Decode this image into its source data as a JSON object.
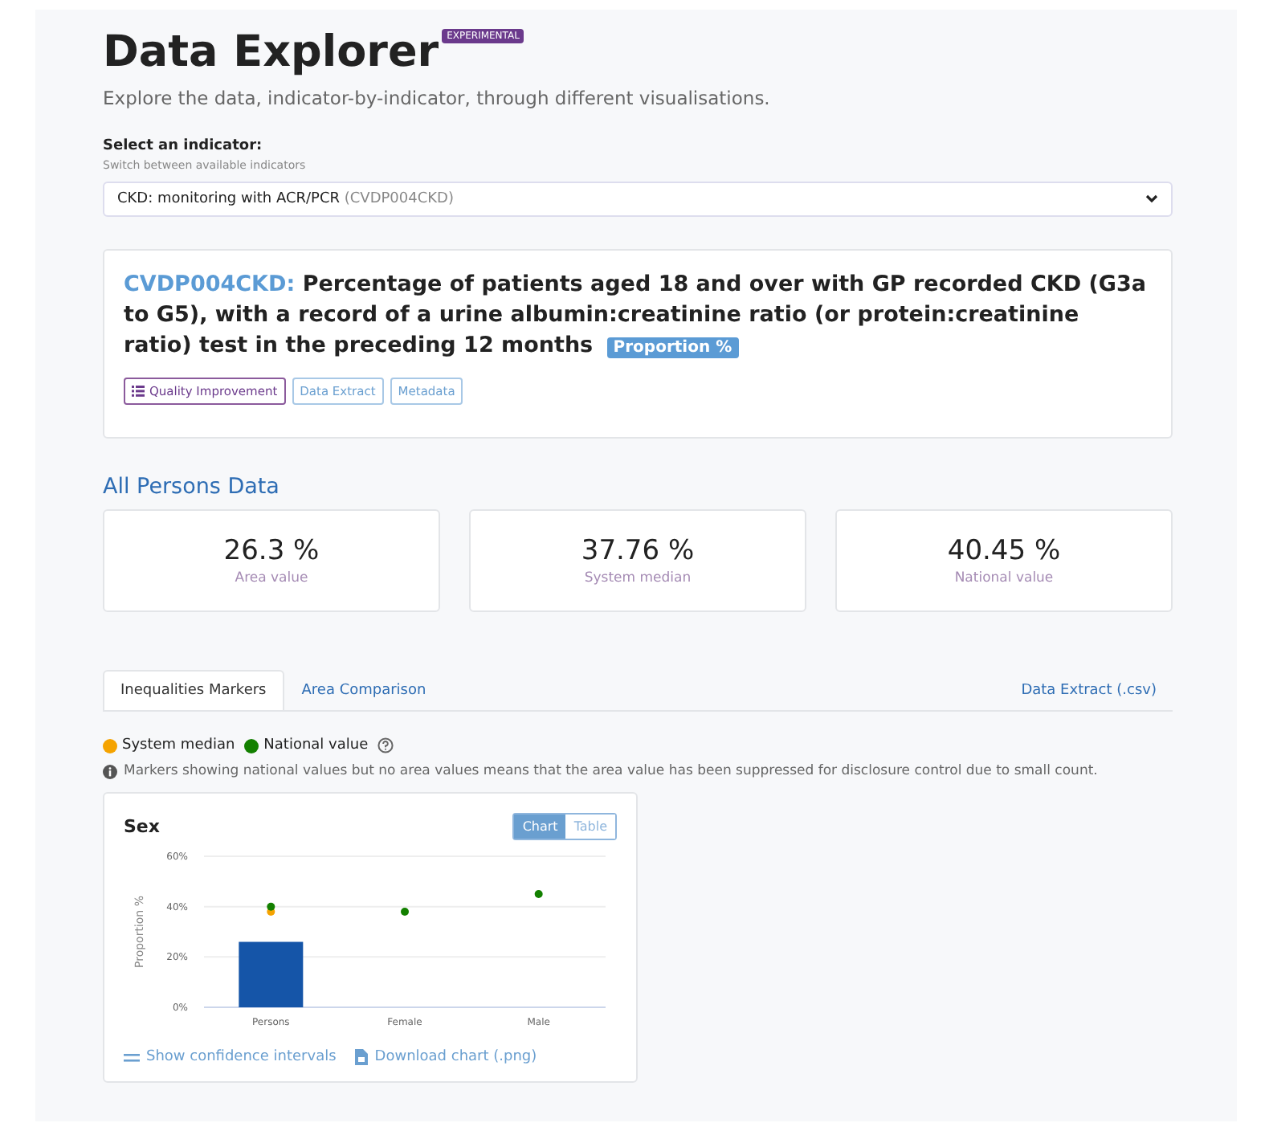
{
  "header": {
    "title": "Data Explorer",
    "badge": "EXPERIMENTAL",
    "subtitle": "Explore the data, indicator-by-indicator, through different visualisations."
  },
  "selector": {
    "label": "Select an indicator:",
    "hint": "Switch between available indicators",
    "value": "CKD: monitoring with ACR/PCR",
    "code": "(CVDP004CKD)"
  },
  "indicator": {
    "code": "CVDP004CKD:",
    "title": "Percentage of patients aged 18 and over with GP recorded CKD (G3a to G5), with a record of a urine albumin:creatinine ratio (or protein:creatinine ratio) test in the preceding 12 months",
    "unit": "Proportion %",
    "buttons": [
      {
        "label": "Quality Improvement",
        "kind": "primary"
      },
      {
        "label": "Data Extract",
        "kind": "plain"
      },
      {
        "label": "Metadata",
        "kind": "plain"
      }
    ]
  },
  "summary": {
    "heading": "All Persons Data",
    "cards": [
      {
        "value": "26.3 %",
        "label": "Area value"
      },
      {
        "value": "37.76 %",
        "label": "System median"
      },
      {
        "value": "40.45 %",
        "label": "National value"
      }
    ]
  },
  "tabs": [
    {
      "label": "Inequalities Markers",
      "selected": true
    },
    {
      "label": "Area Comparison",
      "selected": false
    }
  ],
  "extract_link": "Data Extract (.csv)",
  "legend": [
    {
      "label": "System median",
      "color": "#f5a300"
    },
    {
      "label": "National value",
      "color": "#138000"
    }
  ],
  "note": "Markers showing national values but no area values means that the area value has been suppressed for disclosure control due to small count.",
  "panel": {
    "title": "Sex",
    "toggle": [
      {
        "label": "Chart",
        "selected": true
      },
      {
        "label": "Table",
        "selected": false
      }
    ],
    "chart_data": {
      "type": "bar",
      "ylabel": "Proportion %",
      "categories": [
        "Persons",
        "Female",
        "Male"
      ],
      "ylim": [
        0,
        60
      ],
      "yticks": [
        {
          "value": 0,
          "label": "0%"
        },
        {
          "value": 20,
          "label": "20%"
        },
        {
          "value": 40,
          "label": "40%"
        },
        {
          "value": 60,
          "label": "60%"
        }
      ],
      "series": [
        {
          "type": "bar",
          "color": "#1555a8",
          "values": [
            26,
            null,
            null
          ]
        },
        {
          "type": "scatter",
          "color": "#f5a300",
          "values": [
            38,
            null,
            null
          ]
        },
        {
          "type": "scatter",
          "color": "#138000",
          "values": [
            40,
            38,
            45
          ]
        }
      ]
    },
    "links": [
      "Show confidence intervals",
      "Download chart (.png)"
    ]
  }
}
